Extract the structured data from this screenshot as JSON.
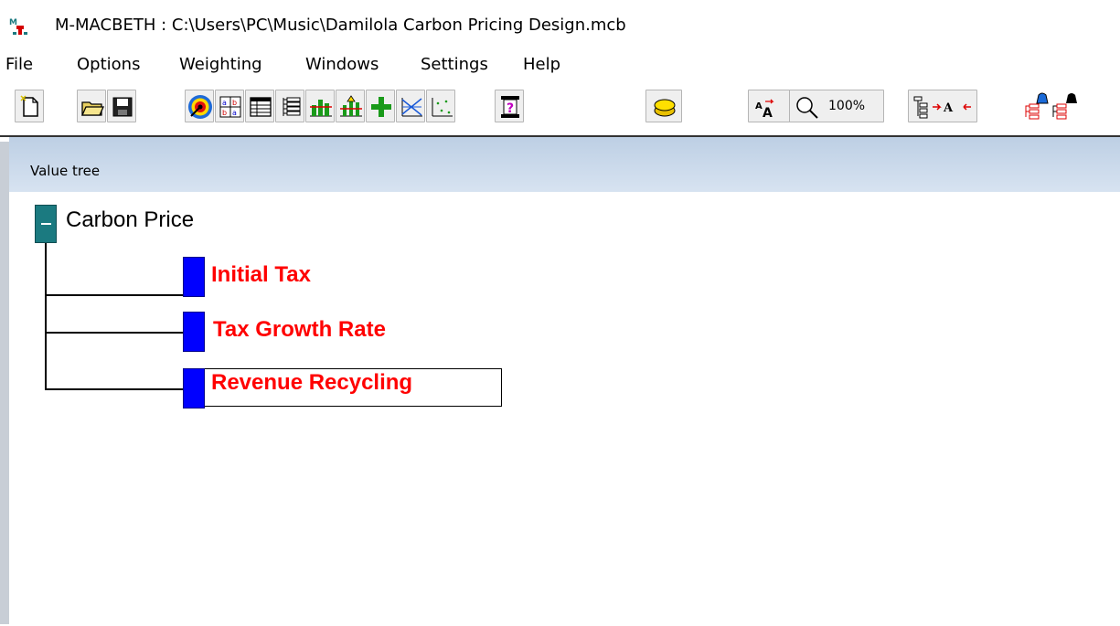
{
  "window": {
    "title": "M-MACBETH : C:\\Users\\PC\\Music\\Damilola Carbon Pricing Design.mcb"
  },
  "menu": [
    "File",
    "Options",
    "Weighting",
    "Windows",
    "Settings",
    "Help"
  ],
  "toolbar": {
    "zoom_label": "100%",
    "icons": [
      "new-file-icon",
      "open-folder-icon",
      "save-icon",
      "target-icon",
      "ab-matrix-icon",
      "table-icon",
      "tree-list-icon",
      "bar-chart-icon",
      "thermometer-chart-icon",
      "add-icon",
      "lines-chart-icon",
      "scatter-icon",
      "question-page-icon",
      "coin-icon",
      "font-size-icon",
      "zoom-icon",
      "tree-expand-icon",
      "weight-red-tree-icon",
      "weight-black-tree-icon"
    ]
  },
  "panel": {
    "title": "Value tree"
  },
  "tree": {
    "root": {
      "label": "Carbon Price"
    },
    "nodes": [
      {
        "label": "Initial Tax",
        "color": "#ff0000"
      },
      {
        "label": "Tax Growth Rate",
        "color": "#ff0000"
      },
      {
        "label": "Revenue Recycling",
        "color": "#ff0000",
        "selected": true
      }
    ]
  },
  "colors": {
    "root_node": "#1b7a80",
    "leaf_node": "#0000ff",
    "leaf_text": "#ff0000"
  }
}
